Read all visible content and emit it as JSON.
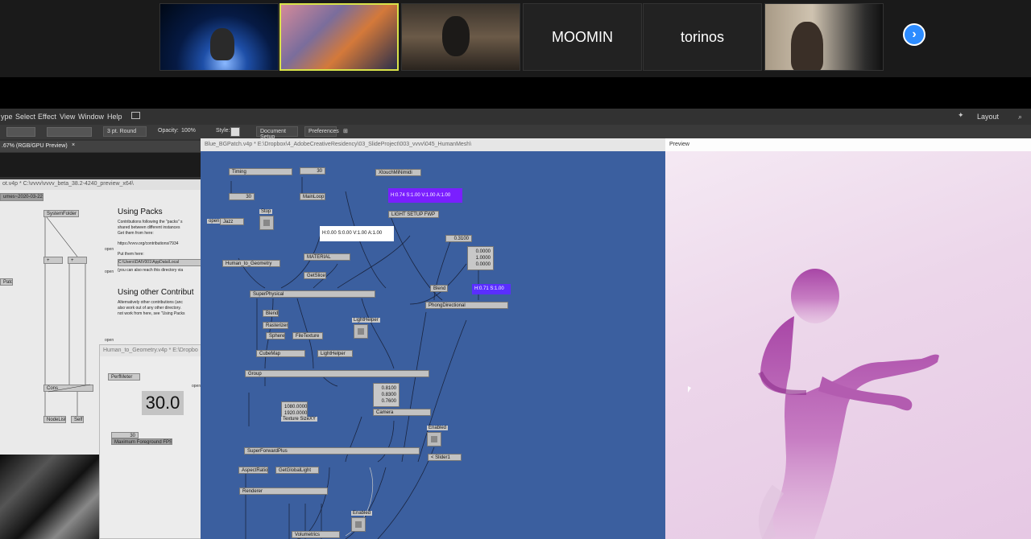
{
  "zoom": {
    "tiles": [
      {
        "name": ""
      },
      {
        "name": ""
      },
      {
        "name": ""
      },
      {
        "name": "MOOMIN"
      },
      {
        "name": "torinos"
      },
      {
        "name": ""
      }
    ],
    "next_icon": "chevron-right-icon"
  },
  "menu": {
    "items": [
      "ype",
      "Select",
      "Effect",
      "View",
      "Window",
      "Help"
    ],
    "layout_label": "Layout"
  },
  "controls": {
    "stroke_value": "3 pt. Round",
    "opacity_label": "Opacity:",
    "opacity_value": "100%",
    "style_label": "Style:",
    "document_setup": "Document Setup",
    "preferences": "Preferences"
  },
  "doc_tab": ".67% (RGB/GPU Preview)",
  "left_window": {
    "title": "ot.v4p *  C:\\vvvv\\vvvv_beta_38.2-4240_preview_x64\\",
    "date_label": "umes~2020-03-22",
    "using_packs_heading": "Using Packs",
    "using_packs_text1": "Contributions following the \"packs\" s",
    "using_packs_text2": "shared between different instances",
    "using_packs_text3": "Get them from here:",
    "open_label": "open",
    "url": "https://vvvv.org/contributions/7934",
    "put_them": "Put them here:",
    "path": "C:\\Users\\DAIV001\\AppData\\Local",
    "reach_text": "(you can also reach this directory via",
    "other_heading": "Using other Contribut",
    "other_text1": "Alternatively other contributions (anc",
    "other_text2": "also work out of any other directory.",
    "other_text3": "not work from here, see \"Using Packs",
    "nodes": {
      "system_folder": "SystemFolder",
      "plus1": "+",
      "plus2": "+",
      "patch": "Patch",
      "cons": "Cons",
      "nodelist": "NodeList",
      "self": "Self"
    }
  },
  "htg_window": {
    "title": "Human_to_Geometry.v4p *  E:\\Dropbo",
    "perfmeter": "PerfMeter",
    "fps_value": "30.0",
    "open_label": "open",
    "fps_input": "30",
    "fps_label": "Maximum Foreground FPS"
  },
  "patch": {
    "title": "Blue_BGPatch.v4p *  E:\\Dropbox\\4_AdobeCreativeResidency\\03_SlideProject\\003_vvvv\\045_HumanMesh\\",
    "nodes": {
      "timing": "Timing",
      "timing_value": "30",
      "mainloop_value": "30",
      "mainloop": "MainLoop",
      "xtouch": "XtouchMiNimidi",
      "hsv_purple": "H:0.74  S:1.00  V:1.00  A:1.00",
      "light_setup": "LIGHT SETUP FWP",
      "stop": "Stop",
      "open": "open",
      "jazz": "Jazz",
      "hsv_white": "H:0.00  S:0.00  V:1.00  A:1.00",
      "value_0310": "0.3100",
      "human_to_geometry": "Human_to_Geometry",
      "material": "MATERIAL",
      "vec1": "0.0000",
      "vec2": "1.0000",
      "vec3": "0.0000",
      "getslice": "GetSlice",
      "blend1": "Blend",
      "hsv_blue": "H:0.71  S:1.00",
      "superphysical": "SuperPhysical",
      "phong": "PhongDirectional",
      "blend2": "Blend",
      "rasterizer": "Rasterizer",
      "lighthelper_label": "LightHelper",
      "sphere": "Sphere",
      "filetexture": "FileTexture",
      "cubemap": "CubeMap",
      "lighthelper": "LightHelper",
      "group": "Group",
      "cam1": "0.8100",
      "cam2": "0.8300",
      "cam3": "0.7600",
      "tex1": "1080.0000",
      "tex2": "1920.0000",
      "texture_size": "Texture SizeXY",
      "camera": "Camera",
      "enabled1": "Enabled",
      "superforwardplus": "SuperForwardPlus",
      "slider": "< Slider1",
      "aspectratio": "AspectRatio",
      "getgloballight": "GetGlobalLight",
      "renderer": "Renderer",
      "enabled2": "Enabled",
      "volumetrics": "Volumetrics"
    }
  },
  "preview": {
    "title": "Preview"
  }
}
